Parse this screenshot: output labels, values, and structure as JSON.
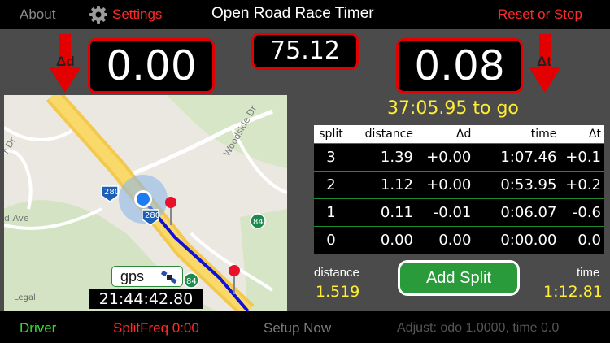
{
  "topbar": {
    "about": "About",
    "settings": "Settings",
    "title": "Open Road Race Timer",
    "reset": "Reset or Stop"
  },
  "timers": {
    "delta_distance_label": "Δd",
    "delta_distance": "0.00",
    "elapsed": "75.12",
    "delta_time": "0.08",
    "delta_time_label": "Δt",
    "to_go": "37:05.95 to go"
  },
  "splits": {
    "headers": [
      "split",
      "distance",
      "Δd",
      "time",
      "Δt"
    ],
    "rows": [
      {
        "split": "3",
        "distance": "1.39",
        "dd": "+0.00",
        "time": "1:07.46",
        "dt": "+0.1"
      },
      {
        "split": "2",
        "distance": "1.12",
        "dd": "+0.00",
        "time": "0:53.95",
        "dt": "+0.2"
      },
      {
        "split": "1",
        "distance": "0.11",
        "dd": "-0.01",
        "time": "0:06.07",
        "dt": "-0.6"
      },
      {
        "split": "0",
        "distance": "0.00",
        "dd": "0.00",
        "time": "0:00.00",
        "dt": "0.0"
      }
    ]
  },
  "stats": {
    "distance_label": "distance",
    "distance_value": "1.519",
    "time_label": "time",
    "time_value": "1:12.81",
    "add_split": "Add Split"
  },
  "map": {
    "road_280": "280",
    "road_84": "84",
    "street": "Woodside Dr",
    "street_ave": "d Ave",
    "street_dr": "r Dr",
    "legal": "Legal",
    "gps": "gps",
    "clock": "21:44:42.80"
  },
  "bottombar": {
    "driver": "Driver",
    "split_freq": "SplitFreq 0:00",
    "setup": "Setup Now",
    "adjust": "Adjust: odo 1.0000, time 0.0"
  },
  "colors": {
    "red": "#e30000",
    "yellow": "#ffee33",
    "green": "#2a9b3a"
  }
}
